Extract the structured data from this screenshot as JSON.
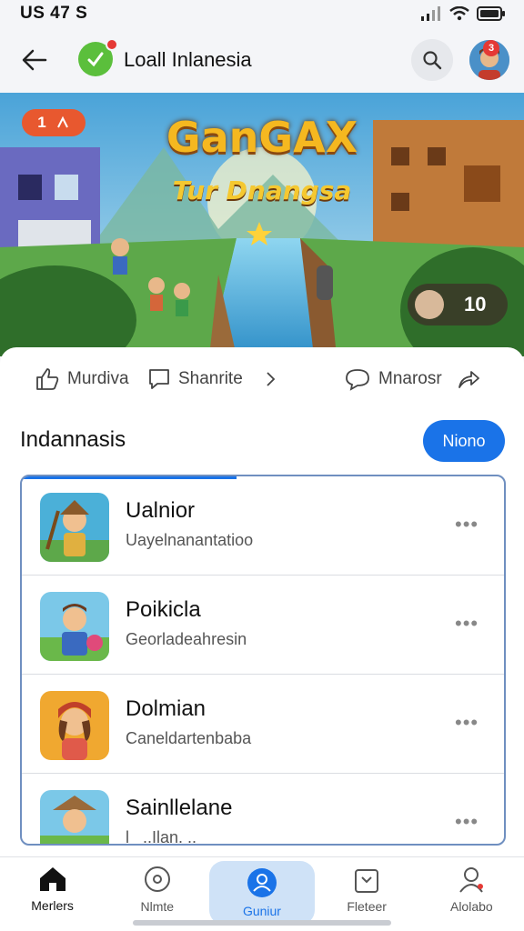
{
  "status": {
    "time": "US 47 S"
  },
  "topbar": {
    "title": "Loall Inlanesia",
    "notification_count": "3"
  },
  "hero": {
    "badge": "1",
    "title_line1": "GanGAX",
    "title_line2": "Tur Dnangsa",
    "viewer_count": "10"
  },
  "actions": {
    "action1": "Murdiva",
    "action2": "Shanrite",
    "action3": "Mnarosr"
  },
  "section": {
    "title": "Indannasis",
    "button": "Niono"
  },
  "list": [
    {
      "name": "Ualnior",
      "sub": "Uayelnanantatioo"
    },
    {
      "name": "Poikicla",
      "sub": "Georladeahresin"
    },
    {
      "name": "Dolmian",
      "sub": "Caneldartenbaba"
    },
    {
      "name": "Sainllelane",
      "sub": "l_ ..Ilan. .."
    }
  ],
  "nav": [
    {
      "label": "Merlers"
    },
    {
      "label": "Nlmte"
    },
    {
      "label": "Guniur"
    },
    {
      "label": "Fleteer"
    },
    {
      "label": "Alolabo"
    }
  ],
  "colors": {
    "accent": "#1a73e8",
    "badge": "#e53935"
  }
}
